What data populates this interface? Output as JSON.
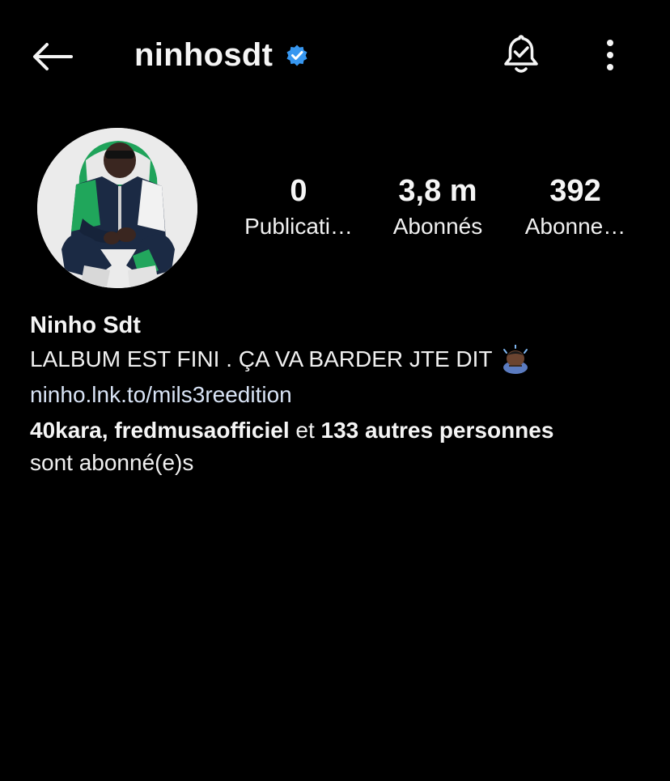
{
  "header": {
    "username": "ninhosdt",
    "verified": true,
    "icons": {
      "back": "arrow-left-icon",
      "verified": "verified-badge-icon",
      "notifications": "bell-check-icon",
      "more": "more-vertical-icon"
    }
  },
  "profile": {
    "avatar_alt": "profile-photo"
  },
  "stats": [
    {
      "value": "0",
      "label": "Publicati…"
    },
    {
      "value": "3,8 m",
      "label": "Abonnés"
    },
    {
      "value": "392",
      "label": "Abonne…"
    }
  ],
  "bio": {
    "name": "Ninho Sdt",
    "text": "LALBUM EST FINI . ÇA VA BARDER JTE DIT",
    "emoji": "bowing-person-emoji",
    "link": "ninho.lnk.to/mils3reedition"
  },
  "followed_by": {
    "accounts": "40kara, fredmusaofficiel",
    "connector": " et ",
    "others": "133 autres personnes",
    "suffix": "sont abonné(e)s"
  },
  "colors": {
    "background": "#000000",
    "text": "#f5f5f5",
    "verified": "#3797f0",
    "link": "#d8e3f5"
  }
}
